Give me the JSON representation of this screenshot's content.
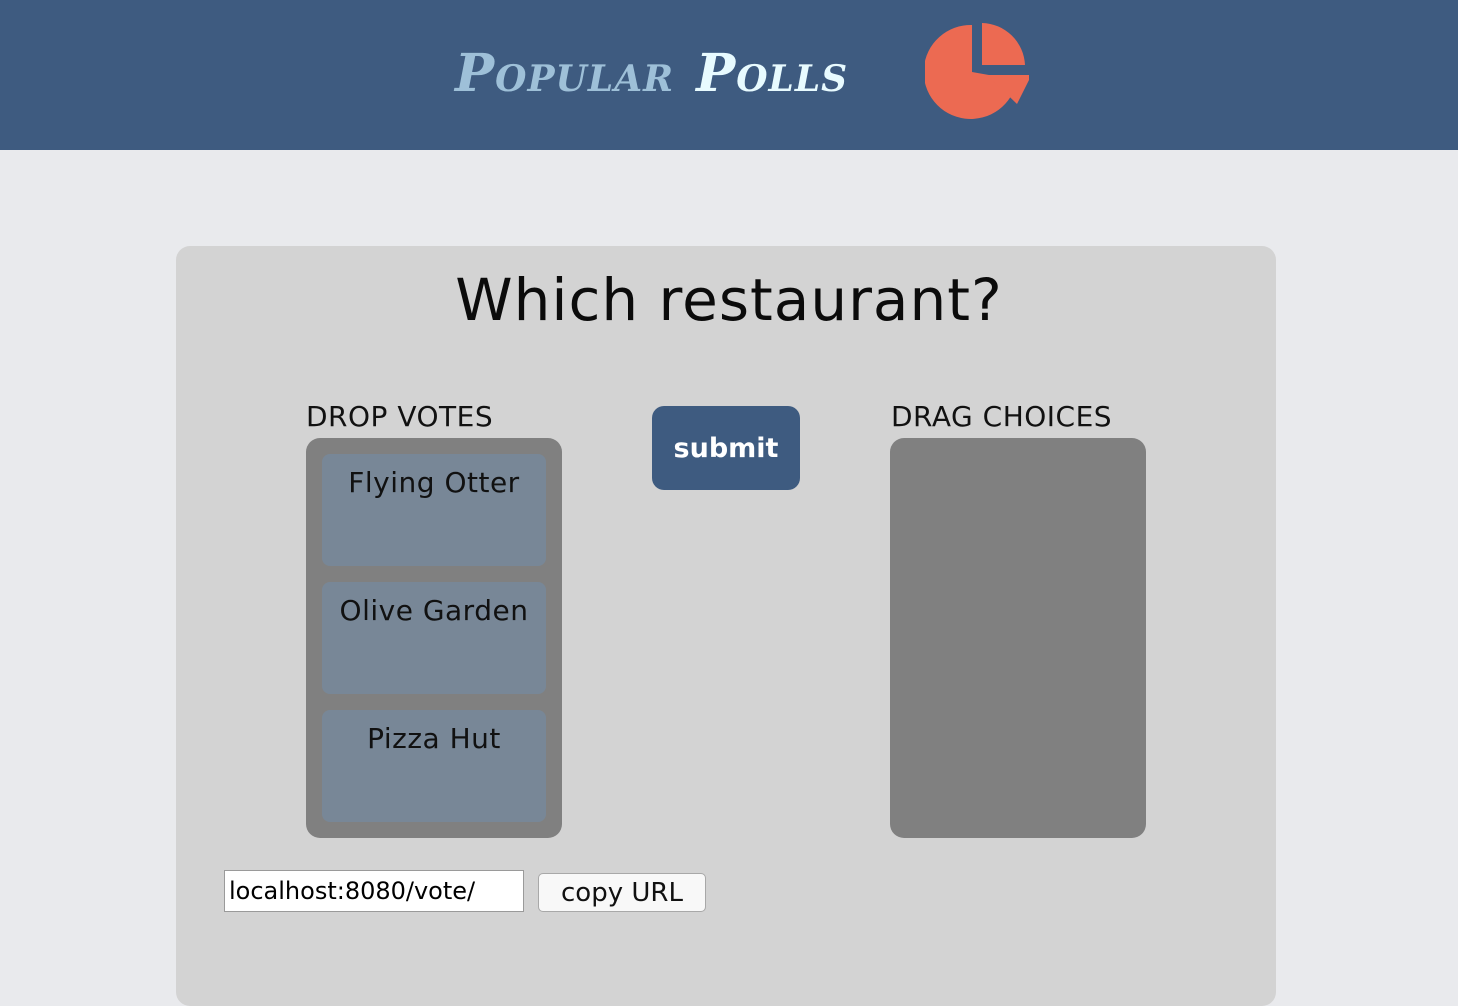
{
  "header": {
    "brand_word_1": "Popular",
    "brand_word_2": "Polls",
    "logo_icon": "pie-chart-icon",
    "background_color": "#3e5b80",
    "logo_color": "#ec6a52"
  },
  "poll": {
    "question": "Which restaurant?",
    "drop_votes_label": "DROP VOTES",
    "drag_choices_label": "DRAG CHOICES",
    "votes": [
      {
        "label": "Flying Otter"
      },
      {
        "label": "Olive Garden"
      },
      {
        "label": "Pizza Hut"
      }
    ],
    "choices": [],
    "submit_label": "submit"
  },
  "share": {
    "url_value": "localhost:8080/vote/",
    "copy_label": "copy URL"
  }
}
